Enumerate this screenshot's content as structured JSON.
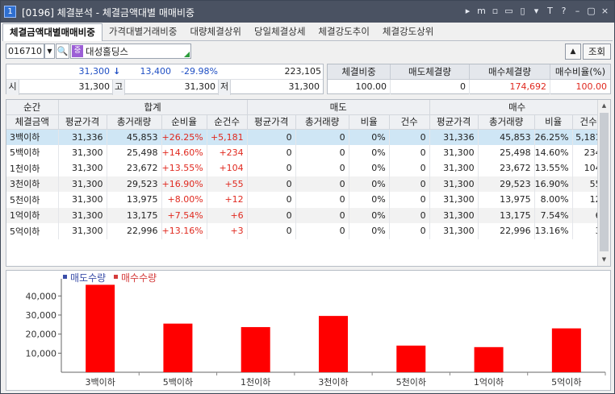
{
  "window": {
    "number": "1",
    "title": "[0196]  체결분석 - 체결금액대별 매매비중"
  },
  "title_buttons": [
    "▸",
    "m",
    "▫",
    "▭",
    "▯",
    "▾",
    "T",
    "?",
    "–",
    "▢",
    "×"
  ],
  "tabs": [
    {
      "label": "체결금액대별매매비중",
      "active": true
    },
    {
      "label": "가격대별거래비중",
      "active": false
    },
    {
      "label": "대량체결상위",
      "active": false
    },
    {
      "label": "당일체결상세",
      "active": false
    },
    {
      "label": "체결강도추이",
      "active": false
    },
    {
      "label": "체결강도상위",
      "active": false
    }
  ],
  "search": {
    "code": "016710",
    "stock_badge": "중",
    "stock_name": "대성홀딩스",
    "up_button": "▲",
    "lookup_button": "조회"
  },
  "price": {
    "current": "31,300",
    "arrow": "↓",
    "change": "13,400",
    "change_pct": "-29.98%",
    "volume": "223,105"
  },
  "ohl": {
    "open_label": "시",
    "open": "31,300",
    "high_label": "고",
    "high": "31,300",
    "low_label": "저",
    "low": "31,300"
  },
  "ratio_box": {
    "headers": [
      "체결비중",
      "매도체결량",
      "매수체결량",
      "매수비율(%)"
    ],
    "values": [
      "100.00",
      "0",
      "174,692",
      "100.00"
    ]
  },
  "table": {
    "corner_top": "순간",
    "corner_bottom": "체결금액",
    "groups": [
      "합계",
      "매도",
      "매수"
    ],
    "subheaders": [
      "평균가격",
      "총거래량",
      "순비율",
      "순건수",
      "평균가격",
      "총거래량",
      "비율",
      "건수",
      "평균가격",
      "총거래량",
      "비율",
      "건수"
    ],
    "rows": [
      [
        "3백이하",
        "31,336",
        "45,853",
        "+26.25%",
        "+5,181",
        "0",
        "0",
        "0%",
        "0",
        "31,336",
        "45,853",
        "26.25%",
        "5,181"
      ],
      [
        "5백이하",
        "31,300",
        "25,498",
        "+14.60%",
        "+234",
        "0",
        "0",
        "0%",
        "0",
        "31,300",
        "25,498",
        "14.60%",
        "234"
      ],
      [
        "1천이하",
        "31,300",
        "23,672",
        "+13.55%",
        "+104",
        "0",
        "0",
        "0%",
        "0",
        "31,300",
        "23,672",
        "13.55%",
        "104"
      ],
      [
        "3천이하",
        "31,300",
        "29,523",
        "+16.90%",
        "+55",
        "0",
        "0",
        "0%",
        "0",
        "31,300",
        "29,523",
        "16.90%",
        "55"
      ],
      [
        "5천이하",
        "31,300",
        "13,975",
        "+8.00%",
        "+12",
        "0",
        "0",
        "0%",
        "0",
        "31,300",
        "13,975",
        "8.00%",
        "12"
      ],
      [
        "1억이하",
        "31,300",
        "13,175",
        "+7.54%",
        "+6",
        "0",
        "0",
        "0%",
        "0",
        "31,300",
        "13,175",
        "7.54%",
        "6"
      ],
      [
        "5억이하",
        "31,300",
        "22,996",
        "+13.16%",
        "+3",
        "0",
        "0",
        "0%",
        "0",
        "31,300",
        "22,996",
        "13.16%",
        "3"
      ]
    ]
  },
  "colors": {
    "bar": "#ff0000",
    "sell_marker": "#3b4ea8",
    "buy_marker": "#d43b3b"
  },
  "chart_data": {
    "type": "bar",
    "categories": [
      "3백이하",
      "5백이하",
      "1천이하",
      "3천이하",
      "5천이하",
      "1억이하",
      "5억이하"
    ],
    "series": [
      {
        "name": "매도수량",
        "values": [
          0,
          0,
          0,
          0,
          0,
          0,
          0
        ]
      },
      {
        "name": "매수수량",
        "values": [
          45853,
          25498,
          23672,
          29523,
          13975,
          13175,
          22996
        ]
      }
    ],
    "yticks": [
      "10,000",
      "20,000",
      "30,000",
      "40,000"
    ],
    "ytick_values": [
      10000,
      20000,
      30000,
      40000
    ],
    "ylim": [
      0,
      49000
    ],
    "legend_placement": "top-left",
    "grid": false
  }
}
